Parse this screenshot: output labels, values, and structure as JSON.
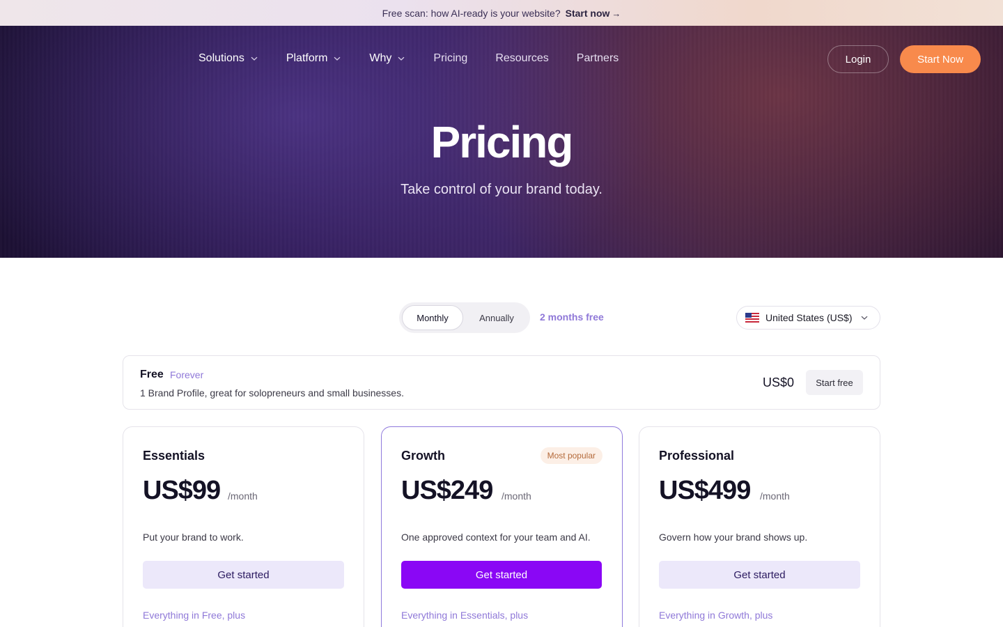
{
  "announcement": {
    "text": "Free scan: how AI-ready is your website?",
    "cta_label": "Start now",
    "cta_arrow": "→"
  },
  "nav": {
    "items": [
      {
        "label": "Solutions",
        "has_dropdown": true
      },
      {
        "label": "Platform",
        "has_dropdown": true
      },
      {
        "label": "Why",
        "has_dropdown": true
      },
      {
        "label": "Pricing",
        "has_dropdown": false
      },
      {
        "label": "Resources",
        "has_dropdown": false
      },
      {
        "label": "Partners",
        "has_dropdown": false
      }
    ],
    "login_label": "Login",
    "start_label": "Start Now"
  },
  "hero": {
    "title": "Pricing",
    "subtitle": "Take control of your brand today."
  },
  "billing": {
    "monthly_label": "Monthly",
    "annually_label": "Annually",
    "selected": "Monthly",
    "save_note": "2 months free"
  },
  "currency": {
    "selected": "United States (US$)",
    "flag_icon": "us-flag-icon"
  },
  "free_plan": {
    "name": "Free",
    "tag": "Forever",
    "description": "1 Brand Profile, great for solopreneurs and small businesses.",
    "price": "US$0",
    "cta_label": "Start free"
  },
  "plans": [
    {
      "name": "Essentials",
      "price": "US$99",
      "period": "/month",
      "description": "Put your brand to work.",
      "cta_label": "Get started",
      "plus_label": "Everything in Free, plus",
      "badge": ""
    },
    {
      "name": "Growth",
      "price": "US$249",
      "period": "/month",
      "description": "One approved context for your team and AI.",
      "cta_label": "Get started",
      "plus_label": "Everything in Essentials, plus",
      "badge": "Most popular"
    },
    {
      "name": "Professional",
      "price": "US$499",
      "period": "/month",
      "description": "Govern how your brand shows up.",
      "cta_label": "Get started",
      "plus_label": "Everything in Growth, plus",
      "badge": ""
    }
  ],
  "colors": {
    "accent_purple": "#8a07f5",
    "accent_orange": "#f88a4c",
    "soft_purple": "#8f78d8"
  }
}
